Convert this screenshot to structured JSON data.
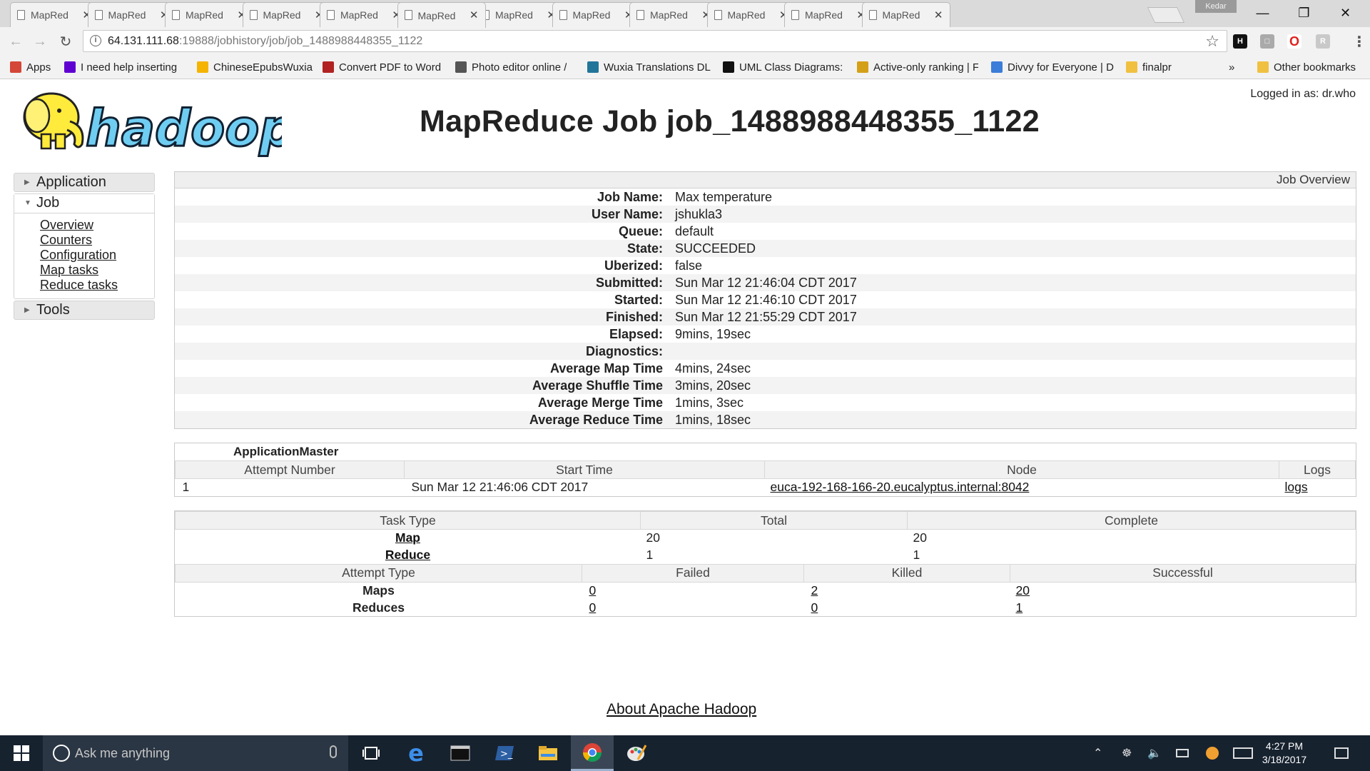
{
  "browser": {
    "tabs": [
      {
        "title": "MapRed",
        "active": false
      },
      {
        "title": "MapRed",
        "active": false
      },
      {
        "title": "MapRed",
        "active": false
      },
      {
        "title": "MapRed",
        "active": false
      },
      {
        "title": "MapRed",
        "active": false
      },
      {
        "title": "MapRed",
        "active": true
      },
      {
        "title": "MapRed",
        "active": false
      },
      {
        "title": "MapRed",
        "active": false
      },
      {
        "title": "MapRed",
        "active": false
      },
      {
        "title": "MapRed",
        "active": false
      },
      {
        "title": "MapRed",
        "active": false
      },
      {
        "title": "MapRed",
        "active": false
      }
    ],
    "profile_name": "Kedar",
    "url_host": "64.131.111.68",
    "url_rest": ":19888/jobhistory/job/job_1488988448355_1122",
    "bookmarks": [
      {
        "label": "Apps",
        "icon": "apps-grid-icon",
        "color": "#d44638"
      },
      {
        "label": "I need help inserting",
        "icon": "yahoo-icon",
        "color": "#5f01d1"
      },
      {
        "label": "ChineseEpubsWuxia",
        "icon": "google-drive-icon",
        "color": "#f4b400"
      },
      {
        "label": "Convert PDF to Word",
        "icon": "pdf-converter-icon",
        "color": "#b22222"
      },
      {
        "label": "Photo editor online /",
        "icon": "pencil-icon",
        "color": "#555555"
      },
      {
        "label": "Wuxia Translations DL",
        "icon": "wordpress-icon",
        "color": "#21759b"
      },
      {
        "label": "UML Class Diagrams:",
        "icon": "m-logo-icon",
        "color": "#111111"
      },
      {
        "label": "Active-only ranking | F",
        "icon": "trophy-icon",
        "color": "#d4a017"
      },
      {
        "label": "Divvy for Everyone | D",
        "icon": "divvy-icon",
        "color": "#3b7dd8"
      },
      {
        "label": "finalpr",
        "icon": "folder-icon",
        "color": "#f0c040"
      }
    ],
    "bookmarks_overflow": "»",
    "other_bookmarks": "Other bookmarks"
  },
  "page": {
    "logged_in": "Logged in as: dr.who",
    "logo_text": "hadoop",
    "title": "MapReduce Job job_1488988448355_1122",
    "nav": {
      "application": "Application",
      "job": "Job",
      "job_links": [
        "Overview",
        "Counters",
        "Configuration",
        "Map tasks",
        "Reduce tasks"
      ],
      "tools": "Tools"
    },
    "overview": {
      "panel_title": "Job Overview",
      "rows": [
        {
          "key": "Job Name:",
          "value": "Max temperature"
        },
        {
          "key": "User Name:",
          "value": "jshukla3"
        },
        {
          "key": "Queue:",
          "value": "default"
        },
        {
          "key": "State:",
          "value": "SUCCEEDED"
        },
        {
          "key": "Uberized:",
          "value": "false"
        },
        {
          "key": "Submitted:",
          "value": "Sun Mar 12 21:46:04 CDT 2017"
        },
        {
          "key": "Started:",
          "value": "Sun Mar 12 21:46:10 CDT 2017"
        },
        {
          "key": "Finished:",
          "value": "Sun Mar 12 21:55:29 CDT 2017"
        },
        {
          "key": "Elapsed:",
          "value": "9mins, 19sec"
        },
        {
          "key": "Diagnostics:",
          "value": ""
        },
        {
          "key": "Average Map Time",
          "value": "4mins, 24sec"
        },
        {
          "key": "Average Shuffle Time",
          "value": "3mins, 20sec"
        },
        {
          "key": "Average Merge Time",
          "value": "1mins, 3sec"
        },
        {
          "key": "Average Reduce Time",
          "value": "1mins, 18sec"
        }
      ]
    },
    "app_master": {
      "title": "ApplicationMaster",
      "headers": [
        "Attempt Number",
        "Start Time",
        "Node",
        "Logs"
      ],
      "row": {
        "attempt": "1",
        "start_time": "Sun Mar 12 21:46:06 CDT 2017",
        "node": "euca-192-168-166-20.eucalyptus.internal:8042",
        "logs": "logs"
      }
    },
    "tasks": {
      "headers": [
        "Task Type",
        "Total",
        "Complete"
      ],
      "rows": [
        {
          "type": "Map",
          "total": "20",
          "complete": "20"
        },
        {
          "type": "Reduce",
          "total": "1",
          "complete": "1"
        }
      ],
      "attempt_headers": [
        "Attempt Type",
        "Failed",
        "Killed",
        "Successful"
      ],
      "attempt_rows": [
        {
          "type": "Maps",
          "failed": "0",
          "killed": "2",
          "successful": "20"
        },
        {
          "type": "Reduces",
          "failed": "0",
          "killed": "0",
          "successful": "1"
        }
      ]
    },
    "footer_link": "About Apache Hadoop"
  },
  "taskbar": {
    "search_placeholder": "Ask me anything",
    "time": "4:27 PM",
    "date": "3/18/2017"
  }
}
